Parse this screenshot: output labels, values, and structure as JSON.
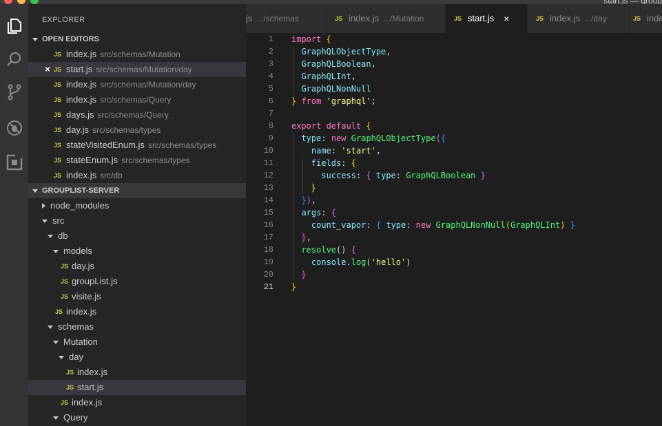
{
  "window": {
    "title": "start.js — group"
  },
  "explorer": {
    "title": "EXPLORER",
    "open_editors": {
      "header": "OPEN EDITORS",
      "items": [
        {
          "name": "index.js",
          "path": "src/schemas/Mutation",
          "selected": false,
          "close": ""
        },
        {
          "name": "start.js",
          "path": "src/schemas/Mutation/day",
          "selected": true,
          "close": "×"
        },
        {
          "name": "index.js",
          "path": "src/schemas/Mutation/day",
          "selected": false,
          "close": ""
        },
        {
          "name": "index.js",
          "path": "src/schemas/Query",
          "selected": false,
          "close": ""
        },
        {
          "name": "days.js",
          "path": "src/schemas/Query",
          "selected": false,
          "close": ""
        },
        {
          "name": "day.js",
          "path": "src/schemas/types",
          "selected": false,
          "close": ""
        },
        {
          "name": "stateVisitedEnum.js",
          "path": "src/schemas/types",
          "selected": false,
          "close": ""
        },
        {
          "name": "stateEnum.js",
          "path": "src/schemas/types",
          "selected": false,
          "close": ""
        },
        {
          "name": "index.js",
          "path": "src/db",
          "selected": false,
          "close": ""
        }
      ]
    },
    "project": {
      "header": "GROUPLIST-SERVER",
      "tree": [
        {
          "label": "node_modules",
          "kind": "folder-closed",
          "depth": 0
        },
        {
          "label": "src",
          "kind": "folder-open",
          "depth": 0
        },
        {
          "label": "db",
          "kind": "folder-open",
          "depth": 1
        },
        {
          "label": "models",
          "kind": "folder-open",
          "depth": 2
        },
        {
          "label": "day.js",
          "kind": "file",
          "depth": 3
        },
        {
          "label": "groupList.js",
          "kind": "file",
          "depth": 3
        },
        {
          "label": "visite.js",
          "kind": "file",
          "depth": 3
        },
        {
          "label": "index.js",
          "kind": "file",
          "depth": 2
        },
        {
          "label": "schemas",
          "kind": "folder-open",
          "depth": 1
        },
        {
          "label": "Mutation",
          "kind": "folder-open",
          "depth": 2
        },
        {
          "label": "day",
          "kind": "folder-open",
          "depth": 3
        },
        {
          "label": "index.js",
          "kind": "file",
          "depth": 4
        },
        {
          "label": "start.js",
          "kind": "file",
          "depth": 4,
          "selected": true
        },
        {
          "label": "index.js",
          "kind": "file",
          "depth": 3
        },
        {
          "label": "Query",
          "kind": "folder-open",
          "depth": 2
        }
      ]
    }
  },
  "file_badge": "JS",
  "tabs": [
    {
      "name": "js",
      "desc": ".../schemas",
      "active": false,
      "badge": false
    },
    {
      "name": "index.js",
      "desc": ".../Mutation",
      "active": false,
      "badge": true
    },
    {
      "name": "start.js",
      "desc": "",
      "active": true,
      "badge": true,
      "close": "×"
    },
    {
      "name": "index.js",
      "desc": ".../day",
      "active": false,
      "badge": true
    },
    {
      "name": "index.js",
      "desc": "",
      "active": false,
      "badge": true
    }
  ],
  "editor": {
    "current_line": 21,
    "lines": [
      [
        [
          "import ",
          "kw"
        ],
        [
          "{",
          "b1"
        ]
      ],
      [
        [
          "  ",
          ""
        ],
        [
          "GraphQLObjectType",
          "pr"
        ],
        [
          ",",
          ""
        ]
      ],
      [
        [
          "  ",
          ""
        ],
        [
          "GraphQLBoolean",
          "pr"
        ],
        [
          ",",
          ""
        ]
      ],
      [
        [
          "  ",
          ""
        ],
        [
          "GraphQLInt",
          "pr"
        ],
        [
          ",",
          ""
        ]
      ],
      [
        [
          "  ",
          ""
        ],
        [
          "GraphQLNonNull",
          "pr"
        ]
      ],
      [
        [
          "}",
          "b1"
        ],
        [
          " from ",
          "kw"
        ],
        [
          "'graphql'",
          "st"
        ],
        [
          ";",
          ""
        ]
      ],
      [],
      [
        [
          "export default ",
          "kw"
        ],
        [
          "{",
          "b1"
        ]
      ],
      [
        [
          "  ",
          ""
        ],
        [
          "type",
          "pr"
        ],
        [
          ": ",
          ""
        ],
        [
          "new ",
          "kw"
        ],
        [
          "GraphQLObjectType",
          "ty"
        ],
        [
          "(",
          "b2"
        ],
        [
          "{",
          "b3"
        ]
      ],
      [
        [
          "    ",
          ""
        ],
        [
          "name",
          "pr"
        ],
        [
          ": ",
          ""
        ],
        [
          "'start'",
          "st"
        ],
        [
          ",",
          ""
        ]
      ],
      [
        [
          "    ",
          ""
        ],
        [
          "fields",
          "pr"
        ],
        [
          ": ",
          ""
        ],
        [
          "{",
          "b1"
        ]
      ],
      [
        [
          "      ",
          ""
        ],
        [
          "success",
          "pr"
        ],
        [
          ": ",
          ""
        ],
        [
          "{",
          "b2"
        ],
        [
          " ",
          ""
        ],
        [
          "type",
          "pr"
        ],
        [
          ": ",
          ""
        ],
        [
          "GraphQLBoolean",
          "ty"
        ],
        [
          " ",
          ""
        ],
        [
          "}",
          "b2"
        ]
      ],
      [
        [
          "    ",
          ""
        ],
        [
          "}",
          "b1"
        ]
      ],
      [
        [
          "  ",
          ""
        ],
        [
          "}",
          "b3"
        ],
        [
          ")",
          "b2"
        ],
        [
          ",",
          ""
        ]
      ],
      [
        [
          "  ",
          ""
        ],
        [
          "args",
          "pr"
        ],
        [
          ": ",
          ""
        ],
        [
          "{",
          "b2"
        ]
      ],
      [
        [
          "    ",
          ""
        ],
        [
          "count_vapor",
          "pr"
        ],
        [
          ": ",
          ""
        ],
        [
          "{",
          "b3"
        ],
        [
          " ",
          ""
        ],
        [
          "type",
          "pr"
        ],
        [
          ": ",
          ""
        ],
        [
          "new ",
          "kw"
        ],
        [
          "GraphQLNonNull",
          "ty"
        ],
        [
          "(",
          "b1"
        ],
        [
          "GraphQLInt",
          "ty"
        ],
        [
          ")",
          "b1"
        ],
        [
          " ",
          ""
        ],
        [
          "}",
          "b3"
        ]
      ],
      [
        [
          "  ",
          ""
        ],
        [
          "}",
          "b2"
        ],
        [
          ",",
          ""
        ]
      ],
      [
        [
          "  ",
          ""
        ],
        [
          "resolve",
          "ty"
        ],
        [
          "() ",
          ""
        ],
        [
          "{",
          "b2"
        ]
      ],
      [
        [
          "    ",
          ""
        ],
        [
          "console",
          "pr"
        ],
        [
          ".",
          ""
        ],
        [
          "log",
          "ty"
        ],
        [
          "(",
          ""
        ],
        [
          "'hello'",
          "st"
        ],
        [
          ")",
          ""
        ]
      ],
      [
        [
          "  ",
          ""
        ],
        [
          "}",
          "b2"
        ]
      ],
      [
        [
          "}",
          "b1"
        ]
      ]
    ]
  }
}
